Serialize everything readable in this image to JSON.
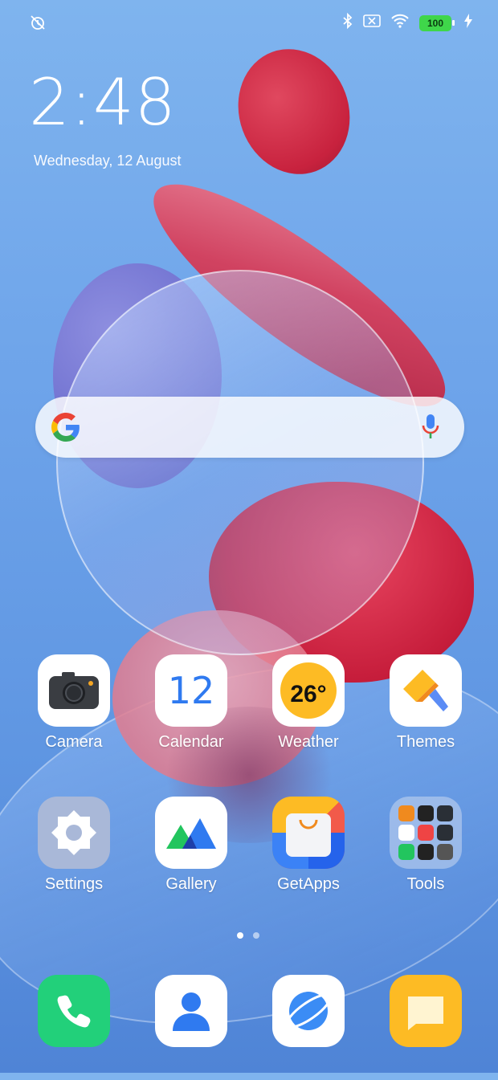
{
  "status_bar": {
    "left_icon": "alarm-off-icon",
    "right_icons": [
      "bluetooth-icon",
      "no-sim-icon",
      "wifi-icon"
    ],
    "battery_level": "100",
    "charging_icon": "charging-bolt-icon"
  },
  "clock": {
    "time": "2:48",
    "date": "Wednesday, 12 August"
  },
  "search": {
    "logo": "google-g-icon",
    "mic": "mic-icon"
  },
  "apps": [
    {
      "label": "Camera",
      "icon": "camera-icon"
    },
    {
      "label": "Calendar",
      "icon": "calendar-icon",
      "icon_text": "12"
    },
    {
      "label": "Weather",
      "icon": "weather-icon",
      "icon_text": "26°"
    },
    {
      "label": "Themes",
      "icon": "themes-icon"
    },
    {
      "label": "Settings",
      "icon": "settings-icon"
    },
    {
      "label": "Gallery",
      "icon": "gallery-icon"
    },
    {
      "label": "GetApps",
      "icon": "getapps-icon"
    },
    {
      "label": "Tools",
      "icon": "tools-folder-icon"
    }
  ],
  "page_indicator": {
    "pages": 2,
    "current": 1
  },
  "dock": [
    {
      "name": "phone-icon",
      "color": "#22d07a"
    },
    {
      "name": "contacts-icon",
      "color": "#ffffff"
    },
    {
      "name": "browser-icon",
      "color": "#ffffff"
    },
    {
      "name": "messages-icon",
      "color": "#fdbb24"
    }
  ],
  "colors": {
    "accent_blue": "#2f7af0",
    "battery_green": "#3fd64a",
    "wallpaper_red": "#c8223e"
  }
}
